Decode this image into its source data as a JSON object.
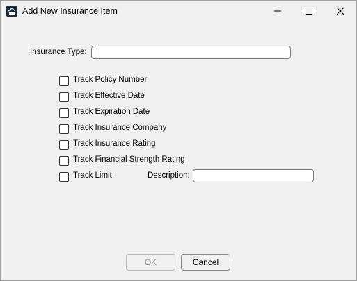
{
  "window": {
    "title": "Add New Insurance Item",
    "icon": "app-logo-icon",
    "controls": [
      "minimize-icon",
      "maximize-icon",
      "close-icon"
    ]
  },
  "form": {
    "insurance_type_label": "Insurance Type:",
    "insurance_type_value": "",
    "checkboxes": [
      {
        "label": "Track Policy Number",
        "checked": false
      },
      {
        "label": "Track Effective Date",
        "checked": false
      },
      {
        "label": "Track Expiration Date",
        "checked": false
      },
      {
        "label": "Track Insurance Company",
        "checked": false
      },
      {
        "label": "Track Insurance Rating",
        "checked": false
      },
      {
        "label": "Track Financial Strength Rating",
        "checked": false
      },
      {
        "label": "Track Limit",
        "checked": false
      }
    ],
    "description_label": "Description:",
    "description_value": ""
  },
  "buttons": {
    "ok_label": "OK",
    "ok_enabled": false,
    "cancel_label": "Cancel"
  }
}
